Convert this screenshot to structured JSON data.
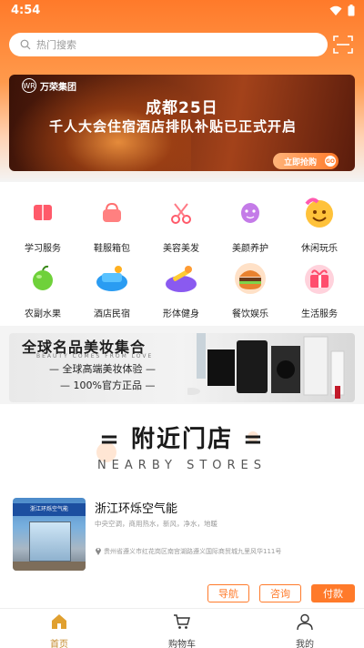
{
  "status_bar": {
    "time": "4:54"
  },
  "search": {
    "placeholder": "热门搜索"
  },
  "banner": {
    "logo_text": "万荣集团",
    "logo_mark": "WR",
    "title_line1": "成都25日",
    "title_line2": "千人大会住宿酒店排队补贴已正式开启",
    "cta": "立即抢购",
    "cta_go": "GO"
  },
  "categories": [
    {
      "label": "学习服务",
      "icon": "book-icon"
    },
    {
      "label": "鞋服箱包",
      "icon": "handbag-icon"
    },
    {
      "label": "美容美发",
      "icon": "scissors-icon"
    },
    {
      "label": "美颜养护",
      "icon": "face-mask-icon"
    },
    {
      "label": "休闲玩乐",
      "icon": "smiley-icon"
    },
    {
      "label": "农副水果",
      "icon": "apple-icon"
    },
    {
      "label": "酒店民宿",
      "icon": "hotel-bed-icon"
    },
    {
      "label": "形体健身",
      "icon": "dumbbell-icon"
    },
    {
      "label": "餐饮娱乐",
      "icon": "burger-icon"
    },
    {
      "label": "生活服务",
      "icon": "gift-icon"
    }
  ],
  "beauty_banner": {
    "title": "全球名品美妆集合",
    "subtitle": "BEAUTY COMES FROM LOVE",
    "line1": "— 全球高端美妆体验 —",
    "line2": "— 100%官方正品 —"
  },
  "nearby": {
    "title": "= 附近门店 =",
    "subtitle": "NEARBY STORES"
  },
  "store": {
    "name": "浙江环烁空气能",
    "tags": "中央空调，商用热水，新风，净水，地暖",
    "address": "贵州省遵义市红花岗区南宫湖路遵义国际商贸城九里风华111号",
    "image_sign": "浙江环烁空气能",
    "buttons": {
      "navigate": "导航",
      "consult": "咨询",
      "pay": "付款"
    }
  },
  "tabbar": [
    {
      "label": "首页",
      "icon": "home-icon",
      "active": true
    },
    {
      "label": "购物车",
      "icon": "cart-icon",
      "active": false
    },
    {
      "label": "我的",
      "icon": "user-icon",
      "active": false
    }
  ],
  "colors": {
    "accent": "#ff7a2a",
    "tab_active": "#c58a2a"
  }
}
